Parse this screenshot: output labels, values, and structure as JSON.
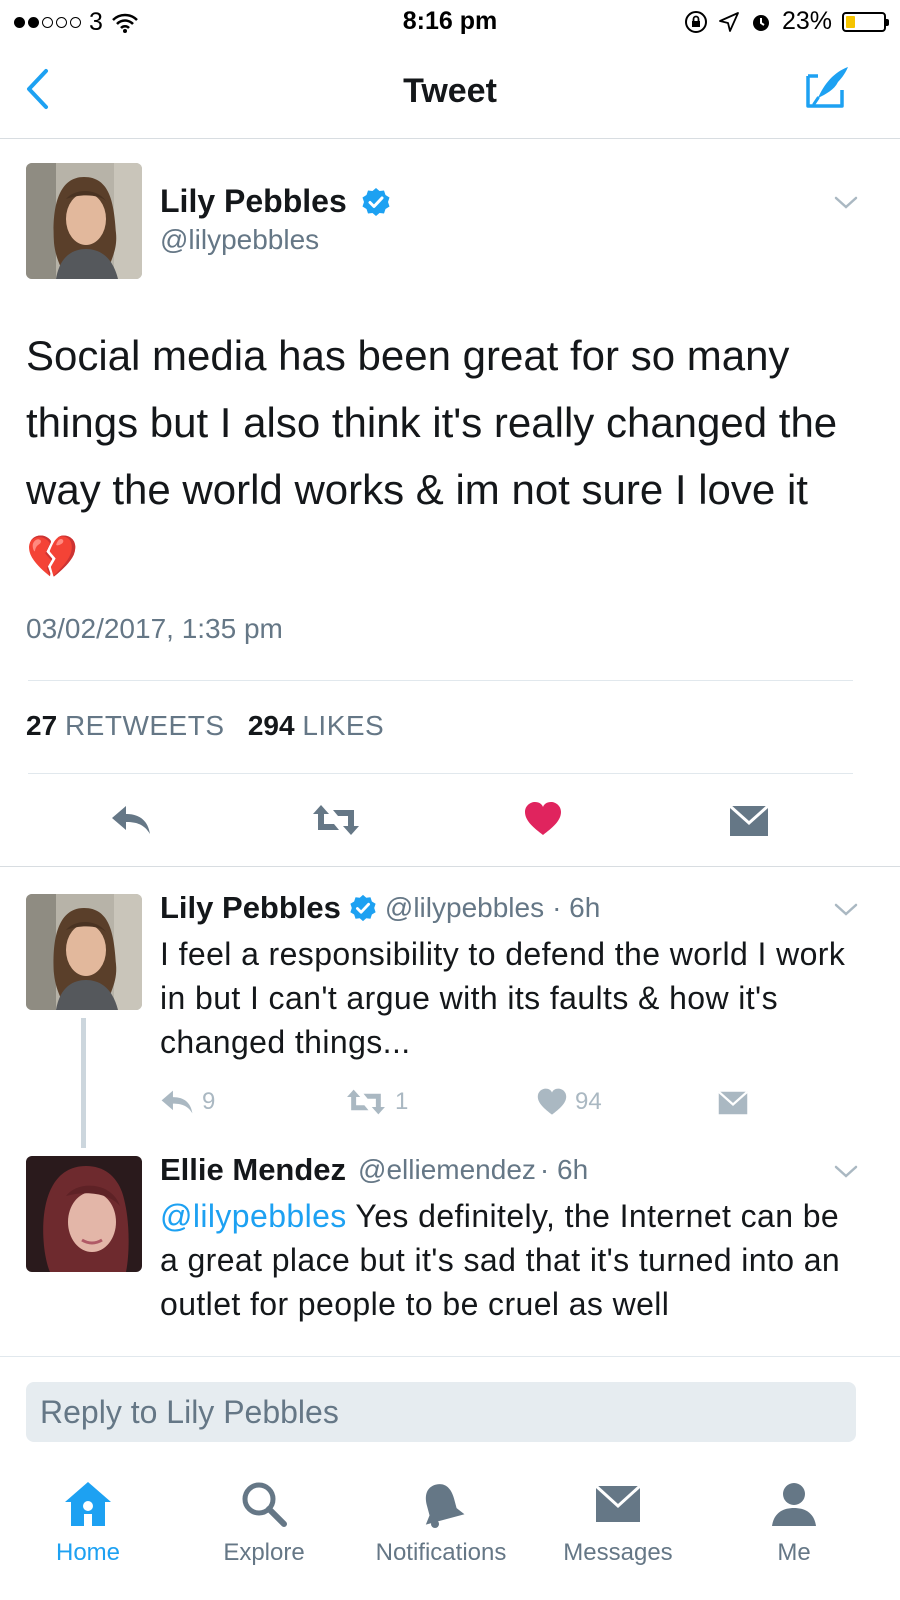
{
  "status_bar": {
    "carrier": "3",
    "time": "8:16 pm",
    "battery": "23%"
  },
  "nav": {
    "title": "Tweet"
  },
  "main_tweet": {
    "name": "Lily Pebbles",
    "handle": "@lilypebbles",
    "text": "Social media has been great for so many things but I also think it's really changed the way the world works & im not sure I love it",
    "emoji": "💔",
    "timestamp": "03/02/2017, 1:35 pm",
    "retweets_count": "27",
    "retweets_label": "RETWEETS",
    "likes_count": "294",
    "likes_label": "LIKES"
  },
  "replies": [
    {
      "name": "Lily Pebbles",
      "handle": "@lilypebbles",
      "time": "· 6h",
      "text": "I feel a responsibility to defend the world I work in but I can't argue with its faults & how it's changed things...",
      "reply_count": "9",
      "retweet_count": "1",
      "like_count": "94"
    },
    {
      "name": "Ellie Mendez",
      "handle": "@elliemendez",
      "time": "· 6h",
      "mention": "@lilypebbles",
      "text": " Yes definitely, the Internet can be a great place but it's sad that it's turned into an outlet for people to be cruel as well"
    }
  ],
  "composer": {
    "placeholder": "Reply to Lily Pebbles"
  },
  "tabs": [
    {
      "label": "Home",
      "icon": "home-icon",
      "active": true
    },
    {
      "label": "Explore",
      "icon": "search-icon"
    },
    {
      "label": "Notifications",
      "icon": "bell-icon"
    },
    {
      "label": "Messages",
      "icon": "envelope-icon"
    },
    {
      "label": "Me",
      "icon": "person-icon"
    }
  ],
  "colors": {
    "accent": "#1da1f2",
    "like": "#e0245e",
    "grey_text": "#657786"
  }
}
